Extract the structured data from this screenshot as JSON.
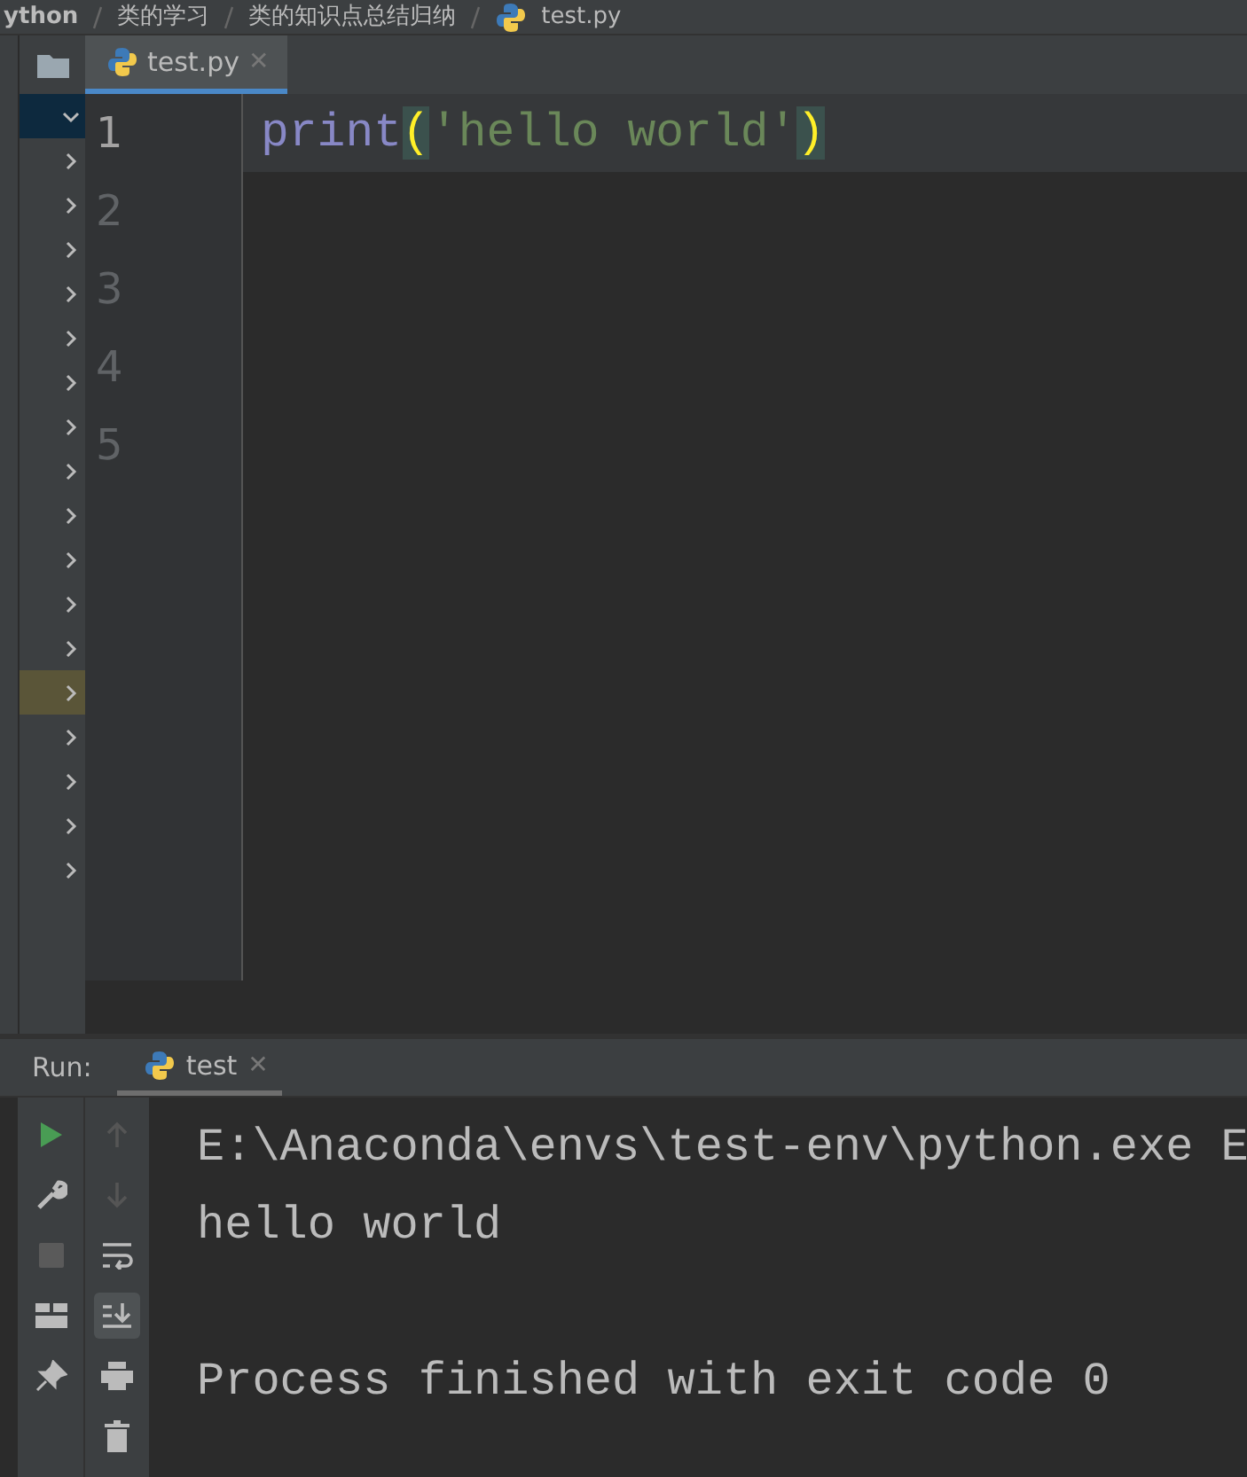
{
  "breadcrumbs": [
    "ython",
    "类的学习",
    "类的知识点总结归纳",
    "test.py"
  ],
  "editor_tabs": [
    {
      "label": "test.py",
      "selected": true,
      "close": "✕"
    }
  ],
  "project_tree": [
    {
      "expanded": true,
      "selected": true,
      "highlighted": false
    },
    {
      "expanded": false,
      "selected": false,
      "highlighted": false
    },
    {
      "expanded": false,
      "selected": false,
      "highlighted": false
    },
    {
      "expanded": false,
      "selected": false,
      "highlighted": false
    },
    {
      "expanded": false,
      "selected": false,
      "highlighted": false
    },
    {
      "expanded": false,
      "selected": false,
      "highlighted": false
    },
    {
      "expanded": false,
      "selected": false,
      "highlighted": false
    },
    {
      "expanded": false,
      "selected": false,
      "highlighted": false
    },
    {
      "expanded": false,
      "selected": false,
      "highlighted": false
    },
    {
      "expanded": false,
      "selected": false,
      "highlighted": false
    },
    {
      "expanded": false,
      "selected": false,
      "highlighted": false
    },
    {
      "expanded": false,
      "selected": false,
      "highlighted": false
    },
    {
      "expanded": false,
      "selected": false,
      "highlighted": false
    },
    {
      "expanded": false,
      "selected": false,
      "highlighted": true
    },
    {
      "expanded": false,
      "selected": false,
      "highlighted": false
    },
    {
      "expanded": false,
      "selected": false,
      "highlighted": false
    },
    {
      "expanded": false,
      "selected": false,
      "highlighted": false
    },
    {
      "expanded": false,
      "selected": false,
      "highlighted": false
    }
  ],
  "code_lines": [
    {
      "number": "1",
      "current": true,
      "tokens": [
        {
          "kind": "builtin",
          "text": "print"
        },
        {
          "kind": "brace",
          "text": "("
        },
        {
          "kind": "string",
          "text": "'hello world'"
        },
        {
          "kind": "brace",
          "text": ")"
        }
      ]
    },
    {
      "number": "2",
      "current": false
    },
    {
      "number": "3",
      "current": false
    },
    {
      "number": "4",
      "current": false
    },
    {
      "number": "5",
      "current": false
    }
  ],
  "run_panel": {
    "label": "Run:",
    "tabs": [
      {
        "label": "test",
        "selected": true,
        "close": "✕"
      }
    ],
    "console": [
      {
        "kind": "command",
        "text": "E:\\Anaconda\\envs\\test-env\\python.exe E"
      },
      {
        "kind": "output",
        "text": "hello world"
      },
      {
        "kind": "exit",
        "text": "Process finished with exit code 0"
      }
    ]
  }
}
